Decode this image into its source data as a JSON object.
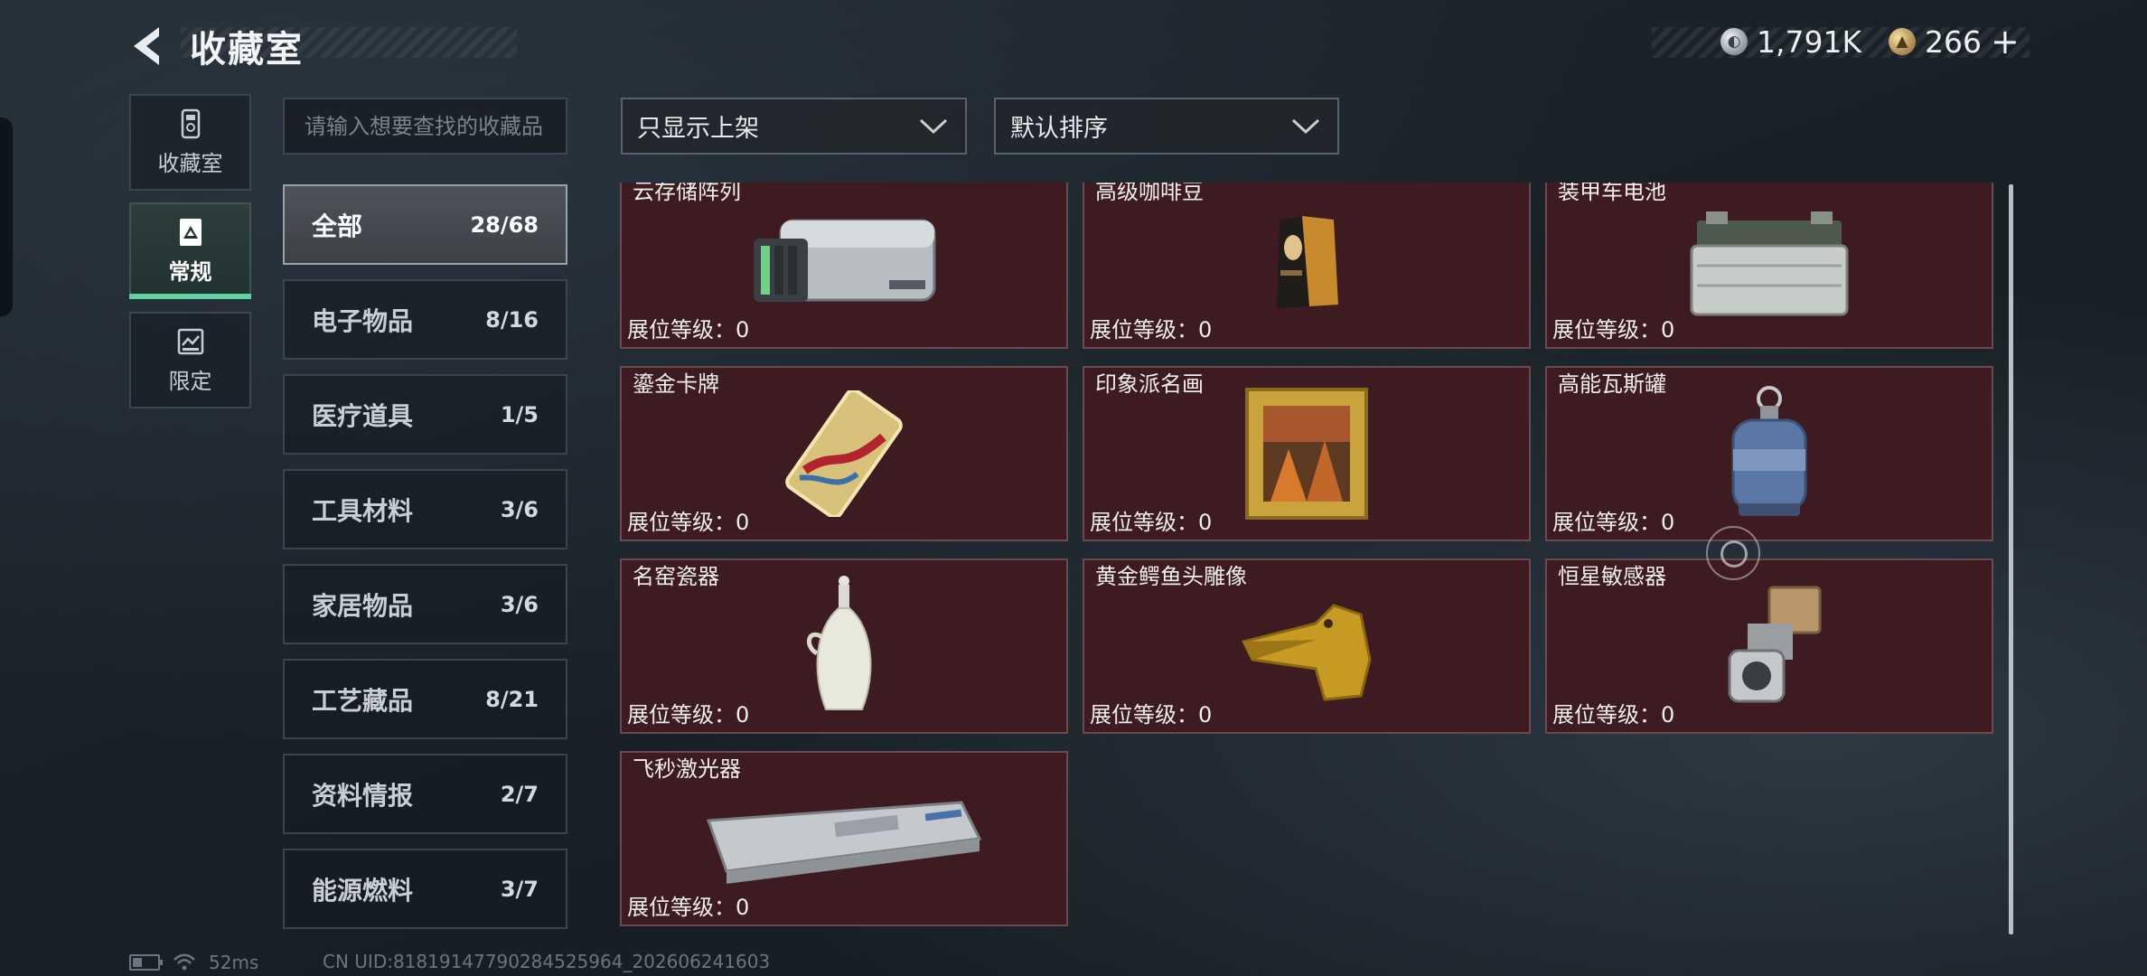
{
  "header": {
    "title": "收藏室"
  },
  "currency": {
    "silver": "1,791K",
    "gold": "266",
    "plus": "+"
  },
  "nav": [
    {
      "label": "收藏室",
      "icon": "collection-room-icon"
    },
    {
      "label": "常规",
      "icon": "regular-exhibit-icon",
      "active": true
    },
    {
      "label": "限定",
      "icon": "limited-exhibit-icon"
    }
  ],
  "search": {
    "placeholder": "请输入想要查找的收藏品",
    "value": ""
  },
  "filters": {
    "shelf_filter": "只显示上架",
    "sort": "默认排序"
  },
  "categories": [
    {
      "label": "全部",
      "count": "28/68",
      "active": true
    },
    {
      "label": "电子物品",
      "count": "8/16"
    },
    {
      "label": "医疗道具",
      "count": "1/5"
    },
    {
      "label": "工具材料",
      "count": "3/6"
    },
    {
      "label": "家居物品",
      "count": "3/6"
    },
    {
      "label": "工艺藏品",
      "count": "8/21"
    },
    {
      "label": "资料情报",
      "count": "2/7"
    },
    {
      "label": "能源燃料",
      "count": "3/7"
    }
  ],
  "items": [
    {
      "name": "云存储阵列",
      "level": "展位等级：0",
      "icon": "storage-array-icon"
    },
    {
      "name": "高级咖啡豆",
      "level": "展位等级：0",
      "icon": "coffee-bean-bag-icon"
    },
    {
      "name": "装甲车电池",
      "level": "展位等级：0",
      "icon": "vehicle-battery-icon"
    },
    {
      "name": "鎏金卡牌",
      "level": "展位等级：0",
      "icon": "gilded-card-icon"
    },
    {
      "name": "印象派名画",
      "level": "展位等级：0",
      "icon": "framed-painting-icon"
    },
    {
      "name": "高能瓦斯罐",
      "level": "展位等级：0",
      "icon": "gas-canister-icon"
    },
    {
      "name": "名窑瓷器",
      "level": "展位等级：0",
      "icon": "porcelain-vase-icon"
    },
    {
      "name": "黄金鳄鱼头雕像",
      "level": "展位等级：0",
      "icon": "gold-crocodile-head-icon"
    },
    {
      "name": "恒星敏感器",
      "level": "展位等级：0",
      "icon": "star-sensor-icon"
    },
    {
      "name": "飞秒激光器",
      "level": "展位等级：0",
      "icon": "femtosecond-laser-icon"
    }
  ],
  "status": {
    "ping": "52ms",
    "uid": "CN UID:81819147790284525964_202606241603"
  }
}
